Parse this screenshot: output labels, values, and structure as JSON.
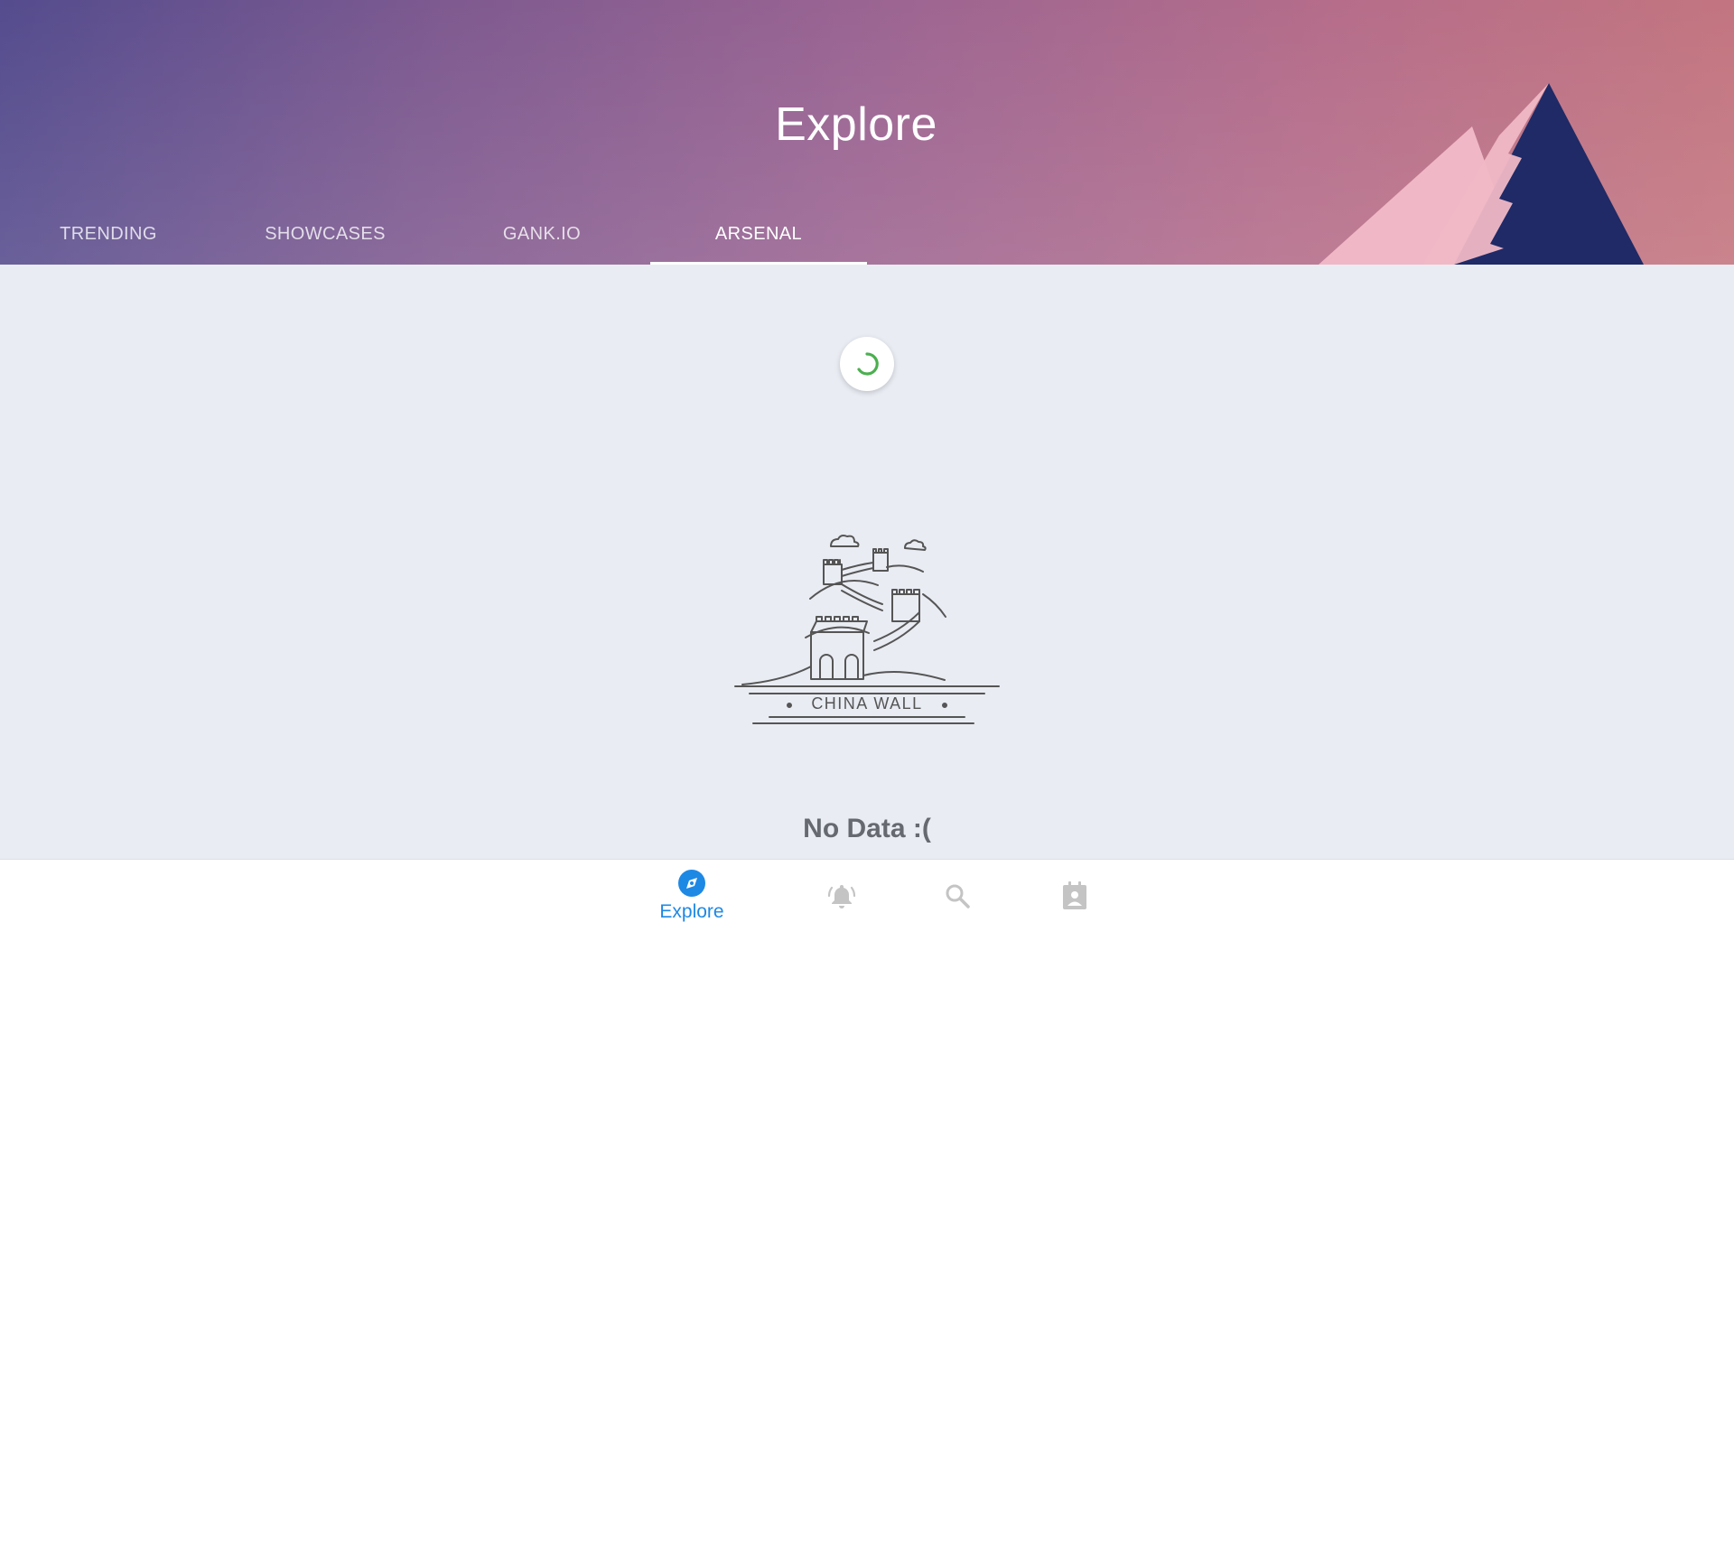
{
  "header": {
    "title": "Explore",
    "tabs": [
      {
        "label": "TRENDING",
        "active": false
      },
      {
        "label": "SHOWCASES",
        "active": false
      },
      {
        "label": "GANK.IO",
        "active": false
      },
      {
        "label": "ARSENAL",
        "active": true
      }
    ]
  },
  "content": {
    "loading_spinner_color": "#4caf50",
    "illustration_caption": "CHINA WALL",
    "empty_message": "No Data :("
  },
  "bottom_nav": {
    "items": [
      {
        "label": "Explore",
        "icon": "compass-icon",
        "active": true
      },
      {
        "label": "",
        "icon": "notifications-bell-icon",
        "active": false
      },
      {
        "label": "",
        "icon": "search-icon",
        "active": false
      },
      {
        "label": "",
        "icon": "contact-card-icon",
        "active": false
      }
    ],
    "active_color": "#1e88e5",
    "inactive_color": "#c4c4c4"
  }
}
